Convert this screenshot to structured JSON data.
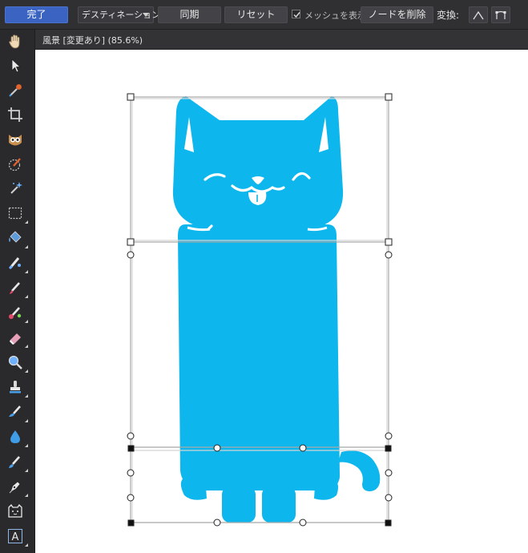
{
  "toolbar": {
    "done_label": "完了",
    "destination_label": "デスティネーション",
    "sync_label": "同期",
    "reset_label": "リセット",
    "show_mesh_label": "メッシュを表示",
    "show_mesh_checked": true,
    "delete_node_label": "ノードを削除",
    "transform_label": "変換:",
    "transform_icons": [
      "sharp-corner-icon",
      "smooth-corner-icon"
    ]
  },
  "document": {
    "title": "風景 [変更あり] (85.6%)"
  },
  "tools": [
    "hand-icon",
    "pointer-icon",
    "color-picker-icon",
    "crop-icon",
    "red-eye-owl-icon",
    "selection-brush-icon",
    "magic-wand-icon",
    "marquee-icon",
    "flood-fill-icon",
    "mixer-brush-icon",
    "paint-brush-icon",
    "color-replacement-brush-icon",
    "erase-brush-icon",
    "zoom-icon",
    "clone-stamp-icon",
    "smudge-brush-icon",
    "blur-drop-icon",
    "inpainting-brush-icon",
    "pen-icon",
    "mesh-warp-cat-icon",
    "text-icon"
  ],
  "colors": {
    "accent": "#3b63c2",
    "cat_fill": "#0db7ed",
    "toolbar_bg": "#303033",
    "canvas_bg": "#ffffff"
  }
}
